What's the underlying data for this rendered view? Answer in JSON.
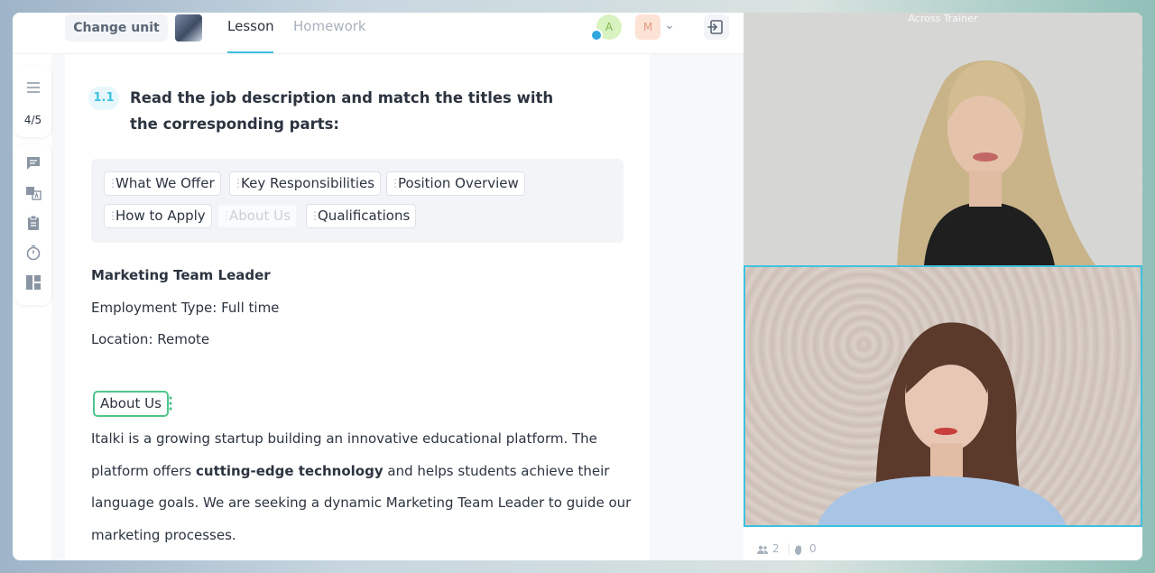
{
  "topbar": {
    "change_unit_label": "Change unit",
    "tabs": [
      {
        "label": "Lesson",
        "active": true
      },
      {
        "label": "Homework",
        "active": false
      }
    ],
    "participants": [
      {
        "initial": "A",
        "color": "#d8f2c0",
        "text_color": "#7bb84e",
        "hand_raised": true
      },
      {
        "initial": "M",
        "color": "#fde2d6",
        "text_color": "#e39a7d"
      }
    ],
    "exit_icon": "exit-icon"
  },
  "sidebar": {
    "page_indicator": "4/5",
    "icons": [
      "list-icon",
      "chat-icon",
      "translate-icon",
      "clipboard-icon",
      "timer-icon",
      "layout-icon"
    ]
  },
  "exercise": {
    "number": "1.1",
    "title": "Read the job description and match the titles with the corresponding parts:",
    "word_bank": [
      {
        "label": "What We Offer",
        "used": false
      },
      {
        "label": "Key Responsibilities",
        "used": false
      },
      {
        "label": "Position Overview",
        "used": false
      },
      {
        "label": "How to Apply",
        "used": false
      },
      {
        "label": "About Us",
        "used": true
      },
      {
        "label": "Qualifications",
        "used": false
      }
    ]
  },
  "job": {
    "title": "Marketing Team Leader",
    "employment_type": "Employment Type: Full time",
    "location": "Location: Remote",
    "placed_heading": "About Us",
    "paragraph": {
      "part1": "Italki is a growing startup building an innovative educational platform. The platform offers ",
      "bold": "cutting-edge technology",
      "part2": " and helps students achieve their language goals. We are seeking a dynamic Marketing Team Leader to guide our marketing processes."
    }
  },
  "video": {
    "top_label": "Across Trainer",
    "participants_count": "2",
    "hands_count": "0",
    "accent": "#3ec1e0"
  }
}
